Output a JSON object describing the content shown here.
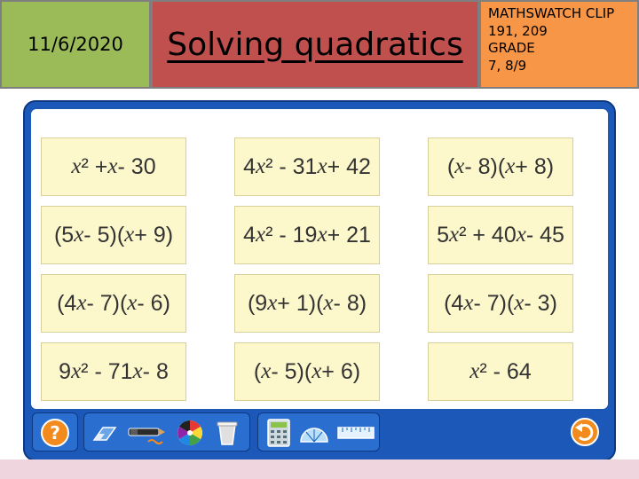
{
  "header": {
    "date": "11/6/2020",
    "title": "Solving quadratics",
    "clip_lines": [
      "MATHSWATCH CLIP",
      "191, 209",
      "GRADE",
      "7, 8/9"
    ]
  },
  "cards": [
    "x² +x - 30",
    "4x² - 31x + 42",
    "(x - 8)(x + 8)",
    "(5x - 5)(x + 9)",
    "4x² - 19x + 21",
    "5x² + 40x - 45",
    "(4x - 7)(x - 6)",
    "(9x + 1)(x - 8)",
    "(4x - 7)(x - 3)",
    "9x² - 71x - 8",
    "(x - 5)(x + 6)",
    "x²  - 64"
  ],
  "toolbar": {
    "help_label": "?",
    "tools": [
      "eraser-icon",
      "pen-icon",
      "color-wheel-icon",
      "bin-icon",
      "calculator-icon",
      "protractor-icon",
      "ruler-icon"
    ],
    "undo_icon": "undo-arrow-icon"
  },
  "colors": {
    "date_bg": "#9bbb59",
    "title_bg": "#c0504d",
    "clip_bg": "#f79646",
    "window_blue": "#1c58b8",
    "card_bg": "#fdf8cc",
    "accent_orange": "#f28a1e"
  }
}
